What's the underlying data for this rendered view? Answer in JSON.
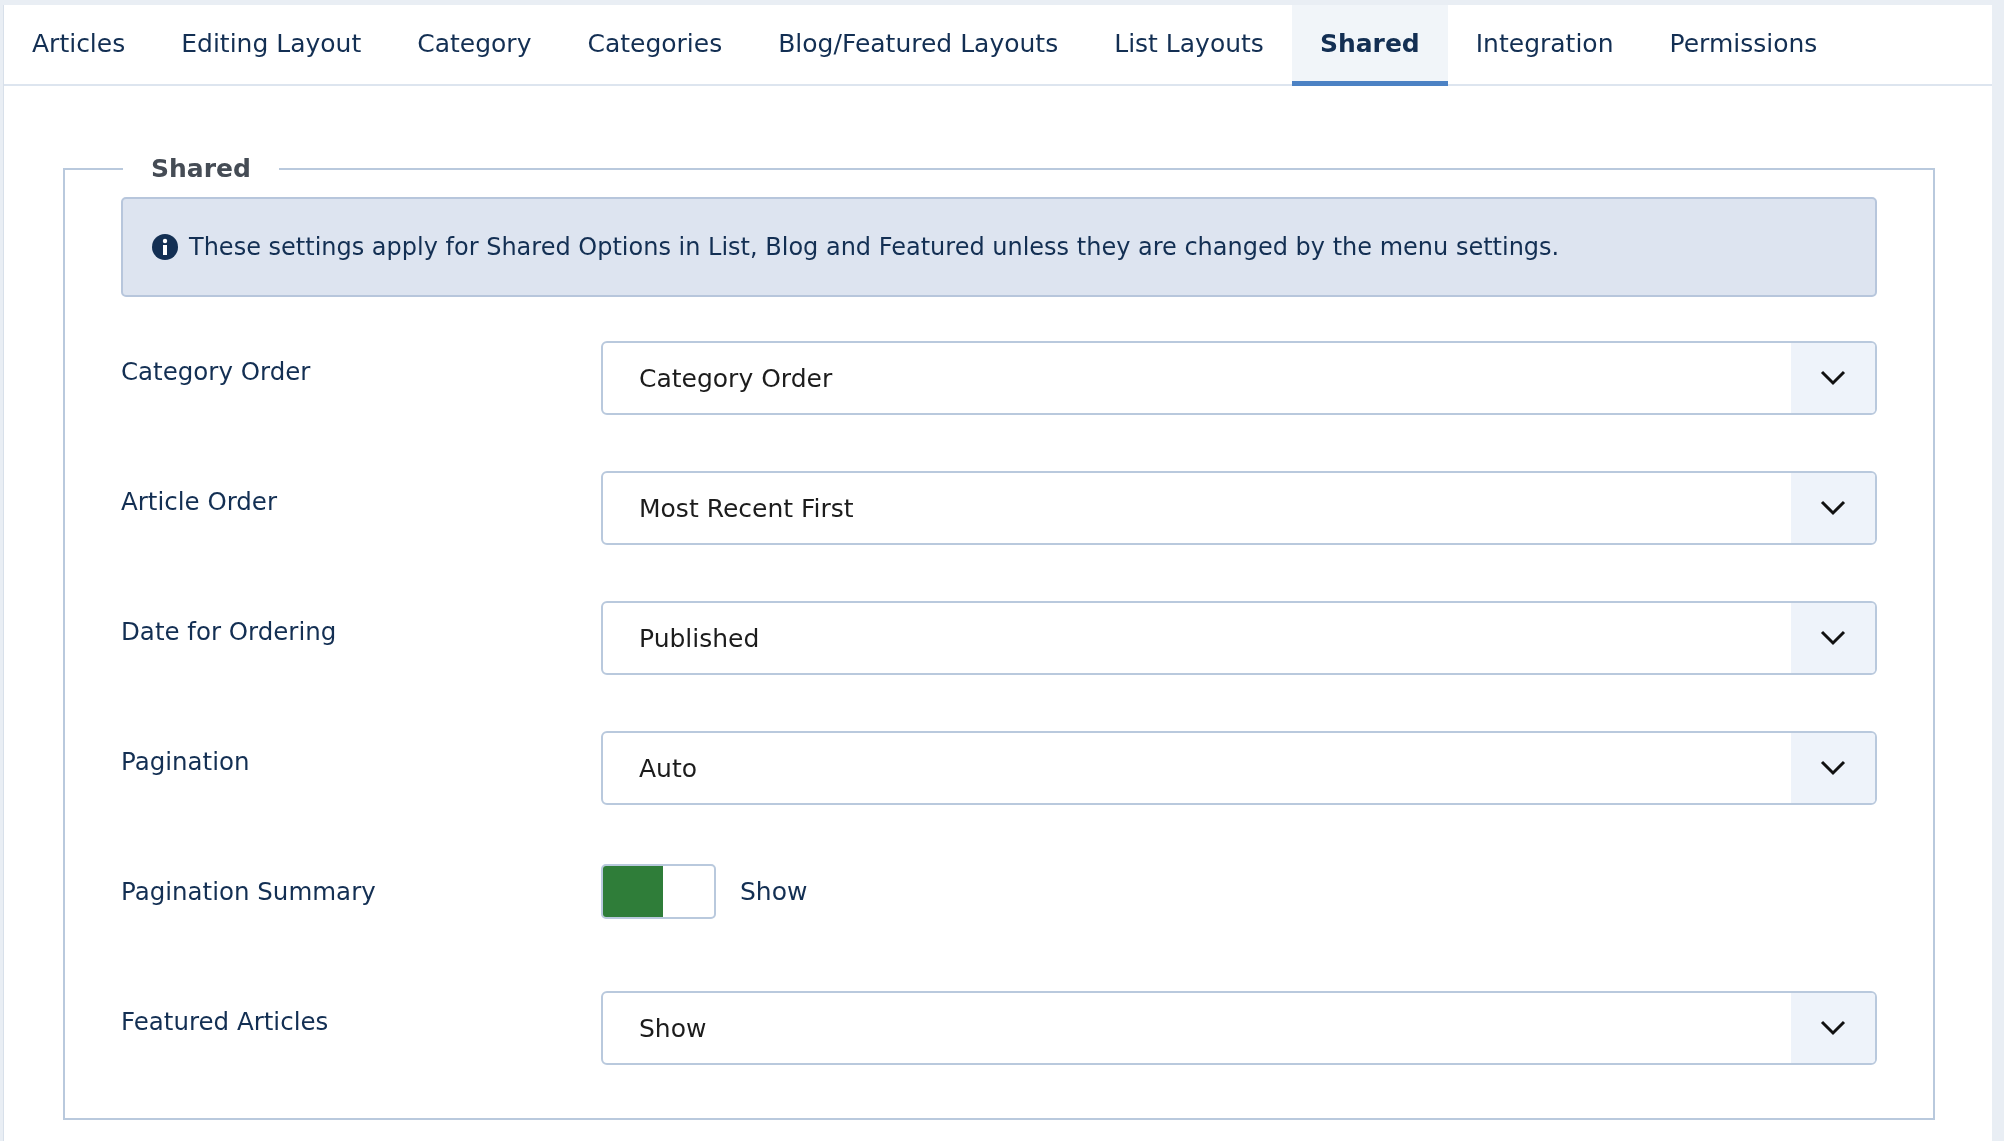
{
  "tabs": [
    {
      "label": "Articles",
      "selected": false
    },
    {
      "label": "Editing Layout",
      "selected": false
    },
    {
      "label": "Category",
      "selected": false
    },
    {
      "label": "Categories",
      "selected": false
    },
    {
      "label": "Blog/Featured Layouts",
      "selected": false
    },
    {
      "label": "List Layouts",
      "selected": false
    },
    {
      "label": "Shared",
      "selected": true
    },
    {
      "label": "Integration",
      "selected": false
    },
    {
      "label": "Permissions",
      "selected": false
    }
  ],
  "fieldset": {
    "legend": "Shared",
    "alert": "These settings apply for Shared Options in List, Blog and Featured unless they are changed by the menu settings.",
    "fields": [
      {
        "kind": "select",
        "label": "Category Order",
        "value": "Category Order"
      },
      {
        "kind": "select",
        "label": "Article Order",
        "value": "Most Recent First"
      },
      {
        "kind": "select",
        "label": "Date for Ordering",
        "value": "Published"
      },
      {
        "kind": "select",
        "label": "Pagination",
        "value": "Auto"
      },
      {
        "kind": "toggle",
        "label": "Pagination Summary",
        "on": true,
        "value": "Show"
      },
      {
        "kind": "select",
        "label": "Featured Articles",
        "value": "Show"
      }
    ]
  }
}
